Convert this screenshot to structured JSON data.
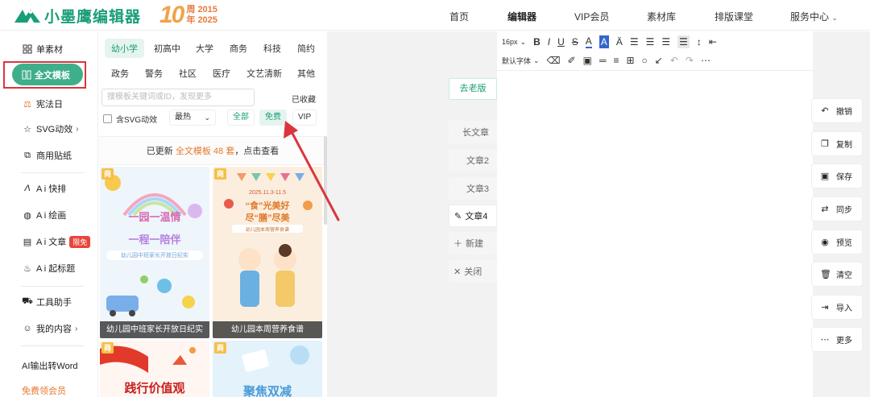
{
  "header": {
    "logo_text": "小墨鹰编辑器",
    "anniversary": {
      "number": "10",
      "zhou": "周",
      "year_start": "2015",
      "nian": "年",
      "year_end": "2025"
    },
    "nav": [
      {
        "label": "首页"
      },
      {
        "label": "编辑器"
      },
      {
        "label": "VIP会员"
      },
      {
        "label": "素材库"
      },
      {
        "label": "排版课堂"
      },
      {
        "label": "服务中心"
      }
    ]
  },
  "sidebar": {
    "items": [
      {
        "label": "单素材",
        "icon": "grid-icon"
      },
      {
        "label": "全文模板",
        "icon": "template-icon"
      },
      {
        "label": "宪法日",
        "icon": "gavel-icon"
      },
      {
        "label": "SVG动效",
        "icon": "star-icon"
      },
      {
        "label": "商用贴纸",
        "icon": "puzzle-icon"
      },
      {
        "label": "A i 快排",
        "icon": "ai-icon"
      },
      {
        "label": "A i 绘画",
        "icon": "palette-icon"
      },
      {
        "label": "A i 文章",
        "icon": "doc-icon",
        "badge": "限免"
      },
      {
        "label": "A i 起标题",
        "icon": "fire-icon"
      },
      {
        "label": "工具助手",
        "icon": "car-icon"
      },
      {
        "label": "我的内容",
        "icon": "user-icon"
      },
      {
        "label": "AI输出转Word"
      },
      {
        "label": "免费领会员"
      }
    ]
  },
  "panel": {
    "categories_row1": [
      "幼小学",
      "初高中",
      "大学",
      "商务",
      "科技",
      "简约"
    ],
    "categories_row2": [
      "政务",
      "警务",
      "社区",
      "医疗",
      "文艺清新",
      "其他"
    ],
    "search_placeholder": "搜模板关键词或ID，发现更多",
    "saved_label": "已收藏",
    "svg_checkbox_label": "含SVG动效",
    "sort_label": "最热",
    "filters": [
      "全部",
      "免费",
      "VIP"
    ],
    "updated": {
      "prefix": "已更新 ",
      "highlight": "全文模板 48 套",
      "suffix": "，点击查看"
    },
    "cards": [
      {
        "tag": "商",
        "title_line1": "一园一温情",
        "title_line2": "一程一陪伴",
        "subtitle": "幼儿园中班家长开放日纪实",
        "caption": "幼儿园中班家长开放日纪实"
      },
      {
        "tag": "商",
        "date": "2025.11.3-11.5",
        "title_line1": "“食”光美好",
        "title_line2": "尽“膳”尽美",
        "subtitle": "幼儿园本周营养食谱",
        "caption": "幼儿园本周营养食谱"
      },
      {
        "tag": "商",
        "title_line1": "践行价值观"
      },
      {
        "tag": "商",
        "title_line1": "聚焦双减"
      }
    ]
  },
  "editor": {
    "go_old_label": "去老版",
    "doc_tabs": [
      {
        "label": "长文章"
      },
      {
        "label": "文章2"
      },
      {
        "label": "文章3"
      },
      {
        "label": "文章4"
      },
      {
        "label": "新建"
      },
      {
        "label": "关闭"
      }
    ],
    "toolbar": {
      "font_size": "16px",
      "font_family": "默认字体"
    }
  },
  "actions": [
    {
      "label": "撤销",
      "icon": "undo-icon"
    },
    {
      "label": "复制",
      "icon": "copy-icon"
    },
    {
      "label": "保存",
      "icon": "save-icon"
    },
    {
      "label": "同步",
      "icon": "sync-icon"
    },
    {
      "label": "预览",
      "icon": "eye-icon"
    },
    {
      "label": "清空",
      "icon": "trash-icon"
    },
    {
      "label": "导入",
      "icon": "import-icon"
    },
    {
      "label": "更多",
      "icon": "more-icon"
    }
  ],
  "colors": {
    "brand": "#1a9e78",
    "active_pill": "#3fae8a",
    "highlight_box": "#d9363e",
    "orange": "#e8762d",
    "arrow": "#d9363e"
  }
}
